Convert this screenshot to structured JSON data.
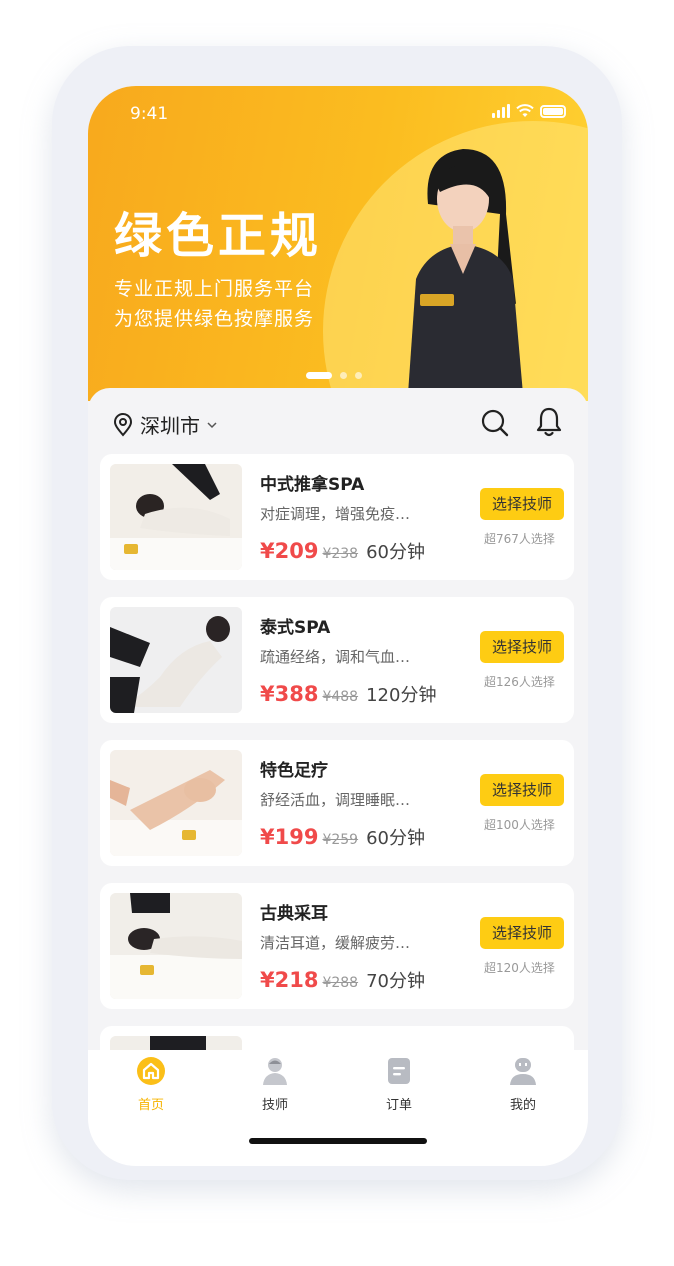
{
  "status": {
    "time": "9:41"
  },
  "banner": {
    "title": "绿色正规",
    "subtitle_line1": "专业正规上门服务平台",
    "subtitle_line2": "为您提供绿色按摩服务",
    "carousel_active_index": 0,
    "carousel_count": 3
  },
  "location": {
    "city": "深圳市"
  },
  "services": [
    {
      "name": "中式推拿SPA",
      "desc": "对症调理，增强免疫…",
      "price": "¥209",
      "orig": "¥238",
      "duration": "60分钟",
      "button": "选择技师",
      "count": "超767人选择"
    },
    {
      "name": "泰式SPA",
      "desc": "疏通经络，调和气血…",
      "price": "¥388",
      "orig": "¥488",
      "duration": "120分钟",
      "button": "选择技师",
      "count": "超126人选择"
    },
    {
      "name": "特色足疗",
      "desc": "舒经活血，调理睡眠…",
      "price": "¥199",
      "orig": "¥259",
      "duration": "60分钟",
      "button": "选择技师",
      "count": "超100人选择"
    },
    {
      "name": "古典采耳",
      "desc": "清洁耳道，缓解疲劳…",
      "price": "¥218",
      "orig": "¥288",
      "duration": "70分钟",
      "button": "选择技师",
      "count": "超120人选择"
    }
  ],
  "tabbar": {
    "items": [
      {
        "label": "首页",
        "icon": "home-icon",
        "active": true
      },
      {
        "label": "技师",
        "icon": "technician-icon",
        "active": false
      },
      {
        "label": "订单",
        "icon": "order-icon",
        "active": false
      },
      {
        "label": "我的",
        "icon": "profile-icon",
        "active": false
      }
    ]
  },
  "colors": {
    "accent": "#fecc13",
    "price": "#f04a4a",
    "tab_active": "#f6b400",
    "banner_start": "#f8a91d",
    "banner_end": "#ffd233"
  }
}
